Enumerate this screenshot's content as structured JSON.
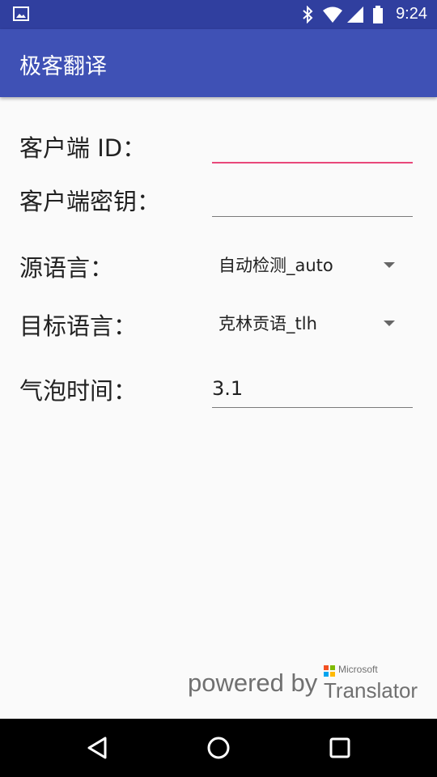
{
  "status_bar": {
    "time": "9:24",
    "icons": [
      "image-notification-icon",
      "bluetooth-icon",
      "wifi-icon",
      "cell-signal-icon",
      "battery-icon"
    ]
  },
  "app_bar": {
    "title": "极客翻译"
  },
  "form": {
    "client_id": {
      "label": "客户端 ID：",
      "value": ""
    },
    "client_secret": {
      "label": "客户端密钥：",
      "value": ""
    },
    "source_lang": {
      "label": "源语言：",
      "value": "自动检测_auto"
    },
    "target_lang": {
      "label": "目标语言：",
      "value": "克林贡语_tlh"
    },
    "bubble_time": {
      "label": "气泡时间：",
      "value": "3.1"
    }
  },
  "footer": {
    "powered_by": "powered by",
    "brand": "Microsoft",
    "product": "Translator"
  },
  "nav_bar": {
    "buttons": [
      "back-icon",
      "home-icon",
      "recents-icon"
    ]
  },
  "colors": {
    "status_bar": "#303f9f",
    "app_bar": "#3f51b5",
    "accent": "#e8487a",
    "ms_red": "#f25022",
    "ms_green": "#7fba00",
    "ms_blue": "#00a4ef",
    "ms_yellow": "#ffb900"
  }
}
